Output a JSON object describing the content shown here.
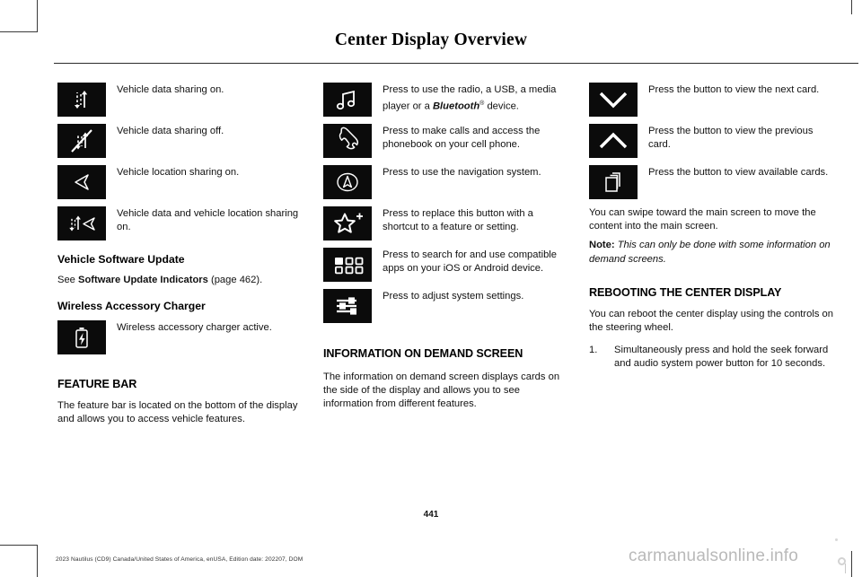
{
  "page": {
    "title": "Center Display Overview",
    "number": "441",
    "footer_meta": "2023 Nautilus (CD9) Canada/United States of America, enUSA, Edition date: 202207, DOM",
    "watermark": "carmanualsonline.info"
  },
  "left_column": {
    "icon_rows": [
      {
        "icon": "data-sharing-on-icon",
        "text": "Vehicle data sharing on."
      },
      {
        "icon": "data-sharing-off-icon",
        "text": "Vehicle data sharing off."
      },
      {
        "icon": "location-sharing-on-icon",
        "text": "Vehicle location sharing on."
      },
      {
        "icon": "data-and-location-sharing-on-icon",
        "text": "Vehicle data and vehicle location sharing on."
      }
    ],
    "software_update_heading": "Vehicle Software Update",
    "software_update_see": "See ",
    "software_update_ref": "Software Update Indicators",
    "software_update_page": " (page 462).",
    "charger_heading": "Wireless Accessory Charger",
    "charger_row": {
      "icon": "wireless-charger-icon",
      "text": "Wireless accessory charger active."
    },
    "feature_bar_heading": "FEATURE BAR",
    "feature_bar_body": "The feature bar is located on the bottom of the display and allows you to access vehicle features."
  },
  "middle_column": {
    "icon_rows": [
      {
        "icon": "media-note-icon",
        "text_before": "Press to use the radio, a USB, a media player or a ",
        "bold_italic": "Bluetooth",
        "registered": "®",
        "text_after": " device."
      },
      {
        "icon": "phone-handset-icon",
        "text": "Press to make calls and access the phonebook on your cell phone."
      },
      {
        "icon": "navigation-compass-icon",
        "text": "Press to use the navigation system."
      },
      {
        "icon": "star-plus-icon",
        "text": "Press to replace this button with a shortcut to a feature or setting."
      },
      {
        "icon": "apps-grid-icon",
        "text": "Press to search for and use compatible apps on your iOS or Android device."
      },
      {
        "icon": "settings-sliders-icon",
        "text": "Press to adjust system settings."
      }
    ],
    "iod_heading": "INFORMATION ON DEMAND SCREEN",
    "iod_body": "The information on demand screen displays cards on the side of the display and allows you to see information from different features."
  },
  "right_column": {
    "icon_rows": [
      {
        "icon": "chevron-down-icon",
        "text": "Press the button to view the next card."
      },
      {
        "icon": "chevron-up-icon",
        "text": "Press the button to view the previous card."
      },
      {
        "icon": "stacked-cards-icon",
        "text": "Press the button to view available cards."
      }
    ],
    "swipe_body": "You can swipe toward the main screen to move the content into the main screen.",
    "note_label": "Note:",
    "note_text": " This can only be done with some information on demand screens.",
    "reboot_heading": "REBOOTING THE CENTER DISPLAY",
    "reboot_body": "You can reboot the center display using the controls on the steering wheel.",
    "reboot_steps": [
      {
        "num": "1.",
        "text": "Simultaneously press and hold the seek forward and audio system power button for 10 seconds."
      }
    ]
  },
  "colors": {
    "ink": "#111111",
    "icon_bg": "#0b0b0b",
    "rule": "#2b2b2b",
    "watermark": "#b9b9b9"
  }
}
